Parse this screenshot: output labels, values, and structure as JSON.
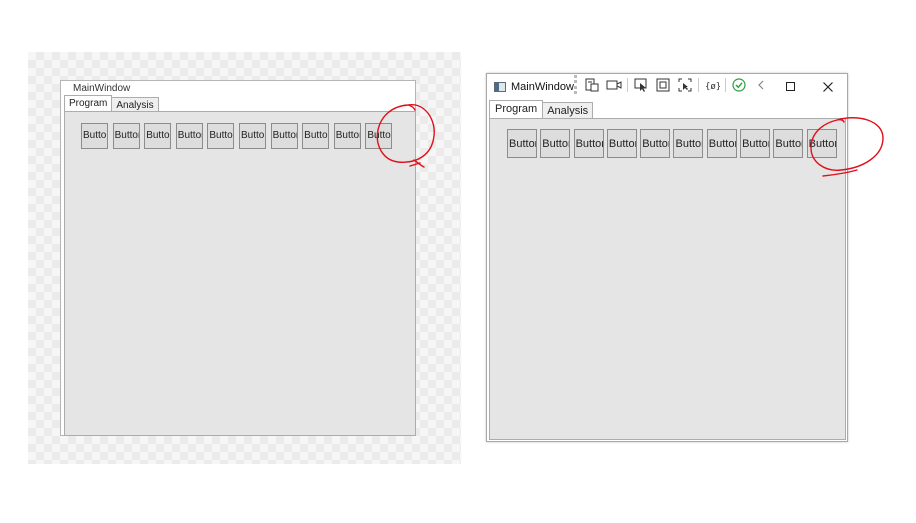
{
  "left": {
    "window_title": "MainWindow",
    "tabs": [
      {
        "label": "Program",
        "selected": true
      },
      {
        "label": "Analysis",
        "selected": false
      }
    ],
    "buttons": [
      "Button",
      "Button",
      "Button",
      "Button",
      "Button",
      "Button",
      "Button",
      "Button",
      "Button",
      "Button"
    ]
  },
  "right": {
    "window_title": "MainWindow",
    "toolbar_icons": [
      "live-visual-tree-icon",
      "record-icon",
      "select-element-icon",
      "display-layout-adorners-icon",
      "track-focus-icon",
      "binding-failures-icon",
      "hot-reload-check-icon",
      "collapse-toolbar-icon"
    ],
    "window_controls": [
      "maximize-icon",
      "close-icon"
    ],
    "tabs": [
      {
        "label": "Program",
        "selected": true
      },
      {
        "label": "Analysis",
        "selected": false
      }
    ],
    "buttons": [
      "Button",
      "Button",
      "Button",
      "Button",
      "Button",
      "Button",
      "Button",
      "Button",
      "Button",
      "Button"
    ]
  },
  "colors": {
    "annotation": "#e0101a",
    "tab_body": "#e5e5e5",
    "check_green": "#2aa13b"
  }
}
